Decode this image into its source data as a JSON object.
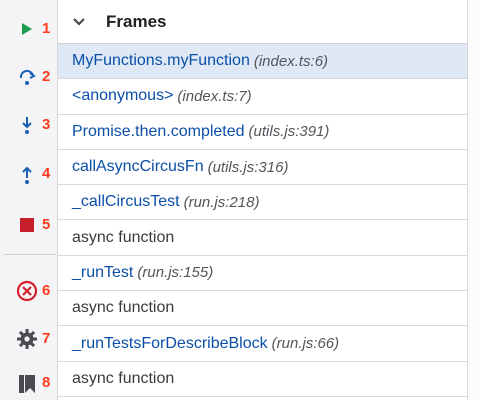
{
  "toolbar": {
    "buttons": [
      {
        "id": "resume",
        "icon": "play-icon",
        "number": "1",
        "color": "#1e9b4a"
      },
      {
        "id": "step-over",
        "icon": "step-over-icon",
        "number": "2",
        "color": "#1a5fb4"
      },
      {
        "id": "step-into",
        "icon": "step-into-icon",
        "number": "3",
        "color": "#1a5fb4"
      },
      {
        "id": "step-out",
        "icon": "step-out-icon",
        "number": "4",
        "color": "#1a5fb4"
      },
      {
        "id": "stop",
        "icon": "stop-icon",
        "number": "5",
        "color": "#c8202a"
      },
      {
        "id": "deactivate-breakpoints",
        "icon": "circle-x-icon",
        "number": "6",
        "color": "#d71f2b"
      },
      {
        "id": "settings",
        "icon": "gear-icon",
        "number": "7",
        "color": "#4a4a50"
      },
      {
        "id": "bookmark",
        "icon": "bookmark-icon",
        "number": "8",
        "color": "#4a4a50"
      }
    ]
  },
  "panel": {
    "title": "Frames",
    "frames": [
      {
        "fn": "MyFunctions.myFunction",
        "loc": "(index.ts:6)",
        "selected": true
      },
      {
        "fn": "<anonymous>",
        "loc": "(index.ts:7)"
      },
      {
        "fn": "Promise.then.completed",
        "loc": "(utils.js:391)"
      },
      {
        "fn": "callAsyncCircusFn",
        "loc": "(utils.js:316)"
      },
      {
        "fn": "_callCircusTest",
        "loc": "(run.js:218)"
      },
      {
        "fn": "async function",
        "loc": "",
        "plain": true
      },
      {
        "fn": "_runTest",
        "loc": "(run.js:155)"
      },
      {
        "fn": "async function",
        "loc": "",
        "plain": true
      },
      {
        "fn": "_runTestsForDescribeBlock",
        "loc": "(run.js:66)"
      },
      {
        "fn": "async function",
        "loc": "",
        "plain": true
      }
    ]
  }
}
